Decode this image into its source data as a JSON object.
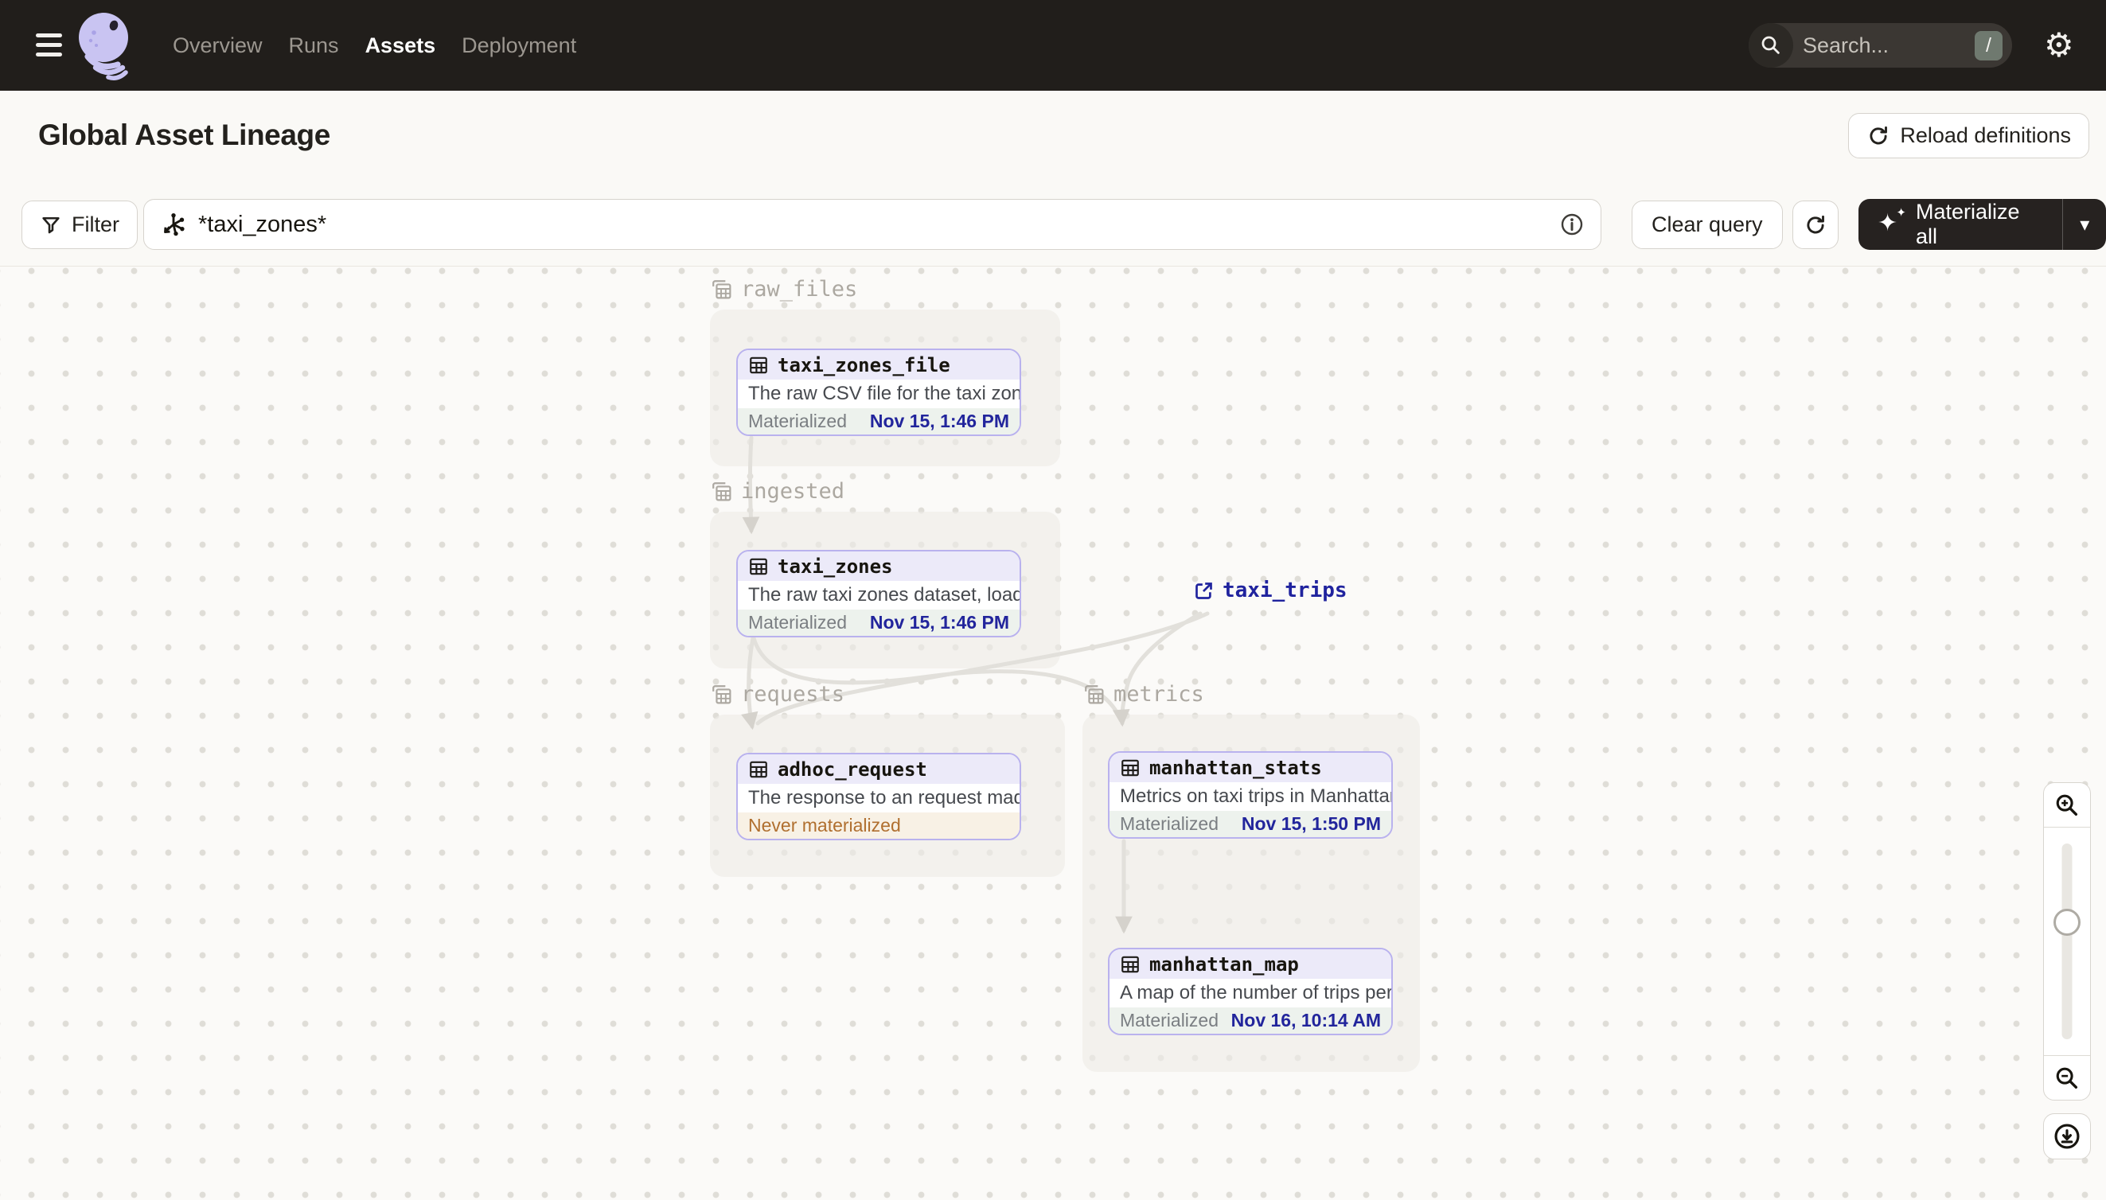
{
  "nav": {
    "items": [
      {
        "label": "Overview",
        "active": false
      },
      {
        "label": "Runs",
        "active": false
      },
      {
        "label": "Assets",
        "active": true
      },
      {
        "label": "Deployment",
        "active": false
      }
    ],
    "search_placeholder": "Search...",
    "search_shortcut": "/"
  },
  "header": {
    "title": "Global Asset Lineage",
    "reload_label": "Reload definitions"
  },
  "toolbar": {
    "filter_label": "Filter",
    "query_value": "*taxi_zones*",
    "clear_label": "Clear query",
    "materialize_label": "Materialize all"
  },
  "graph": {
    "groups": [
      {
        "name": "raw_files"
      },
      {
        "name": "ingested"
      },
      {
        "name": "requests"
      },
      {
        "name": "metrics"
      }
    ],
    "nodes": [
      {
        "name": "taxi_zones_file",
        "group": "raw_files",
        "description": "The raw CSV file for the taxi zones dat...",
        "status": "materialized",
        "status_label": "Materialized",
        "status_time": "Nov 15, 1:46 PM"
      },
      {
        "name": "taxi_zones",
        "group": "ingested",
        "description": "The raw taxi zones dataset, loaded int...",
        "status": "materialized",
        "status_label": "Materialized",
        "status_time": "Nov 15, 1:46 PM"
      },
      {
        "name": "adhoc_request",
        "group": "requests",
        "description": "The response to an request made in th...",
        "status": "never",
        "status_label": "Never materialized",
        "status_time": ""
      },
      {
        "name": "manhattan_stats",
        "group": "metrics",
        "description": "Metrics on taxi trips in Manhattan",
        "status": "materialized",
        "status_label": "Materialized",
        "status_time": "Nov 15, 1:50 PM"
      },
      {
        "name": "manhattan_map",
        "group": "metrics",
        "description": "A map of the number of trips per taxi z...",
        "status": "materialized",
        "status_label": "Materialized",
        "status_time": "Nov 16, 10:14 AM"
      }
    ],
    "external_assets": [
      {
        "name": "taxi_trips"
      }
    ],
    "edges": [
      {
        "from": "taxi_zones_file",
        "to": "taxi_zones"
      },
      {
        "from": "taxi_zones",
        "to": "adhoc_request"
      },
      {
        "from": "taxi_zones",
        "to": "manhattan_stats"
      },
      {
        "from": "taxi_trips",
        "to": "adhoc_request"
      },
      {
        "from": "taxi_trips",
        "to": "manhattan_stats"
      },
      {
        "from": "manhattan_stats",
        "to": "manhattan_map"
      }
    ]
  },
  "icons": {
    "settings_glyph": "⚙",
    "caret_glyph": "▾",
    "sparkle_glyph": "✦",
    "sparkle_small_glyph": "✦"
  },
  "colors": {
    "nav_bg": "#211E1B",
    "accent_purple": "#B9B2EE",
    "node_header_bg": "#ECEAF9",
    "materialized_bg": "#EDF2ED",
    "materialized_time": "#22259C",
    "never_materialized_bg": "#F8F1E5",
    "never_materialized_text": "#B06F2F",
    "edge": "#E2E0DB"
  }
}
